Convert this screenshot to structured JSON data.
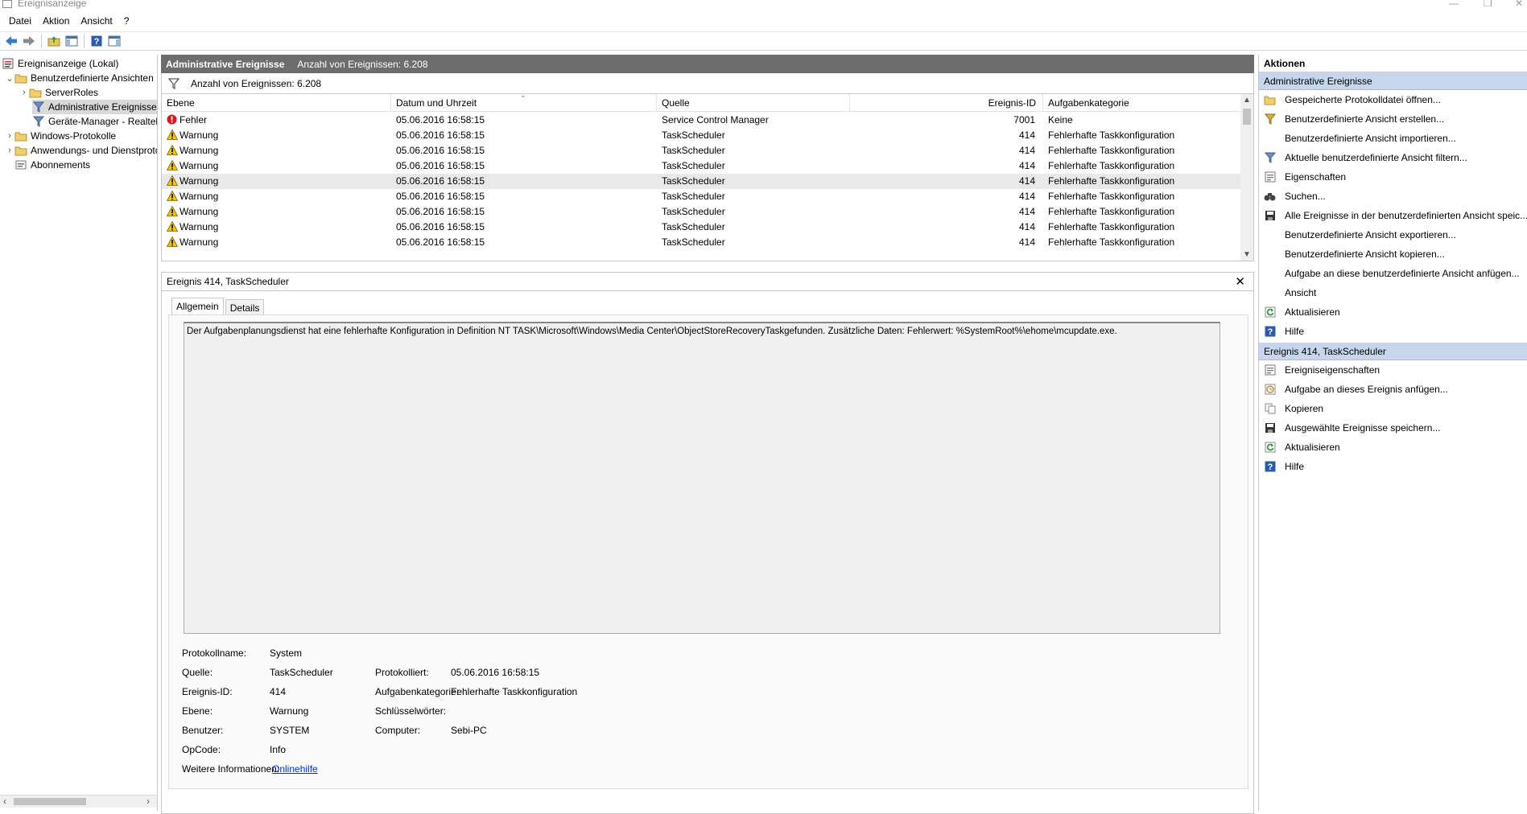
{
  "window": {
    "title": "Ereignisanzeige"
  },
  "menu": [
    "Datei",
    "Aktion",
    "Ansicht",
    "?"
  ],
  "tree": {
    "root": "Ereignisanzeige (Lokal)",
    "custom_views": "Benutzerdefinierte Ansichten",
    "server_roles": "ServerRoles",
    "admin_events": "Administrative Ereignisse",
    "device_manager": "Geräte-Manager - Realtek",
    "windows_logs": "Windows-Protokolle",
    "app_logs": "Anwendungs- und Dienstprotokolle",
    "subscriptions": "Abonnements"
  },
  "center": {
    "title": "Administrative Ereignisse",
    "count": "Anzahl von Ereignissen: 6.208",
    "filter_text": "Anzahl von Ereignissen: 6.208"
  },
  "grid": {
    "columns": [
      "Ebene",
      "Datum und Uhrzeit",
      "Quelle",
      "Ereignis-ID",
      "Aufgabenkategorie"
    ],
    "rows": [
      {
        "level": "Fehler",
        "type": "error",
        "date": "05.06.2016 16:58:15",
        "source": "Service Control Manager",
        "id": "7001",
        "category": "Keine"
      },
      {
        "level": "Warnung",
        "type": "warning",
        "date": "05.06.2016 16:58:15",
        "source": "TaskScheduler",
        "id": "414",
        "category": "Fehlerhafte Taskkonfiguration"
      },
      {
        "level": "Warnung",
        "type": "warning",
        "date": "05.06.2016 16:58:15",
        "source": "TaskScheduler",
        "id": "414",
        "category": "Fehlerhafte Taskkonfiguration"
      },
      {
        "level": "Warnung",
        "type": "warning",
        "date": "05.06.2016 16:58:15",
        "source": "TaskScheduler",
        "id": "414",
        "category": "Fehlerhafte Taskkonfiguration"
      },
      {
        "level": "Warnung",
        "type": "warning",
        "date": "05.06.2016 16:58:15",
        "source": "TaskScheduler",
        "id": "414",
        "category": "Fehlerhafte Taskkonfiguration"
      },
      {
        "level": "Warnung",
        "type": "warning",
        "date": "05.06.2016 16:58:15",
        "source": "TaskScheduler",
        "id": "414",
        "category": "Fehlerhafte Taskkonfiguration"
      },
      {
        "level": "Warnung",
        "type": "warning",
        "date": "05.06.2016 16:58:15",
        "source": "TaskScheduler",
        "id": "414",
        "category": "Fehlerhafte Taskkonfiguration"
      },
      {
        "level": "Warnung",
        "type": "warning",
        "date": "05.06.2016 16:58:15",
        "source": "TaskScheduler",
        "id": "414",
        "category": "Fehlerhafte Taskkonfiguration"
      },
      {
        "level": "Warnung",
        "type": "warning",
        "date": "05.06.2016 16:58:15",
        "source": "TaskScheduler",
        "id": "414",
        "category": "Fehlerhafte Taskkonfiguration"
      }
    ]
  },
  "detail": {
    "title": "Ereignis 414, TaskScheduler",
    "tabs": [
      "Allgemein",
      "Details"
    ],
    "message": "Der Aufgabenplanungsdienst hat eine fehlerhafte Konfiguration in Definition NT TASK\\Microsoft\\Windows\\Media Center\\ObjectStoreRecoveryTaskgefunden. Zusätzliche Daten: Fehlerwert: %SystemRoot%\\ehome\\mcupdate.exe.",
    "labels": {
      "log_name": "Protokollname:",
      "source": "Quelle:",
      "event_id": "Ereignis-ID:",
      "level": "Ebene:",
      "user": "Benutzer:",
      "opcode": "OpCode:",
      "more_info": "Weitere Informationen:",
      "logged": "Protokolliert:",
      "task_category": "Aufgabenkategorie:",
      "keywords": "Schlüsselwörter:",
      "computer": "Computer:"
    },
    "values": {
      "log_name": "System",
      "source": "TaskScheduler",
      "event_id": "414",
      "level": "Warnung",
      "user": "SYSTEM",
      "opcode": "Info",
      "more_info": "Onlinehilfe",
      "logged": "05.06.2016 16:58:15",
      "task_category": "Fehlerhafte Taskkonfiguration",
      "keywords": "",
      "computer": "Sebi-PC"
    }
  },
  "actions": {
    "title": "Aktionen",
    "section1": "Administrative Ereignisse",
    "items1": [
      {
        "label": "Gespeicherte Protokolldatei öffnen...",
        "icon": "open-folder-icon"
      },
      {
        "label": "Benutzerdefinierte Ansicht erstellen...",
        "icon": "filter-create-icon"
      },
      {
        "label": "Benutzerdefinierte Ansicht importieren...",
        "icon": ""
      },
      {
        "label": "Aktuelle benutzerdefinierte Ansicht filtern...",
        "icon": "filter-icon"
      },
      {
        "label": "Eigenschaften",
        "icon": "properties-icon"
      },
      {
        "label": "Suchen...",
        "icon": "binoculars-icon"
      },
      {
        "label": "Alle Ereignisse in der benutzerdefinierten Ansicht speic...",
        "icon": "save-icon"
      },
      {
        "label": "Benutzerdefinierte Ansicht exportieren...",
        "icon": ""
      },
      {
        "label": "Benutzerdefinierte Ansicht kopieren...",
        "icon": ""
      },
      {
        "label": "Aufgabe an diese benutzerdefinierte Ansicht anfügen...",
        "icon": ""
      },
      {
        "label": "Ansicht",
        "icon": ""
      },
      {
        "label": "Aktualisieren",
        "icon": "refresh-icon"
      },
      {
        "label": "Hilfe",
        "icon": "help-icon"
      }
    ],
    "section2": "Ereignis 414, TaskScheduler",
    "items2": [
      {
        "label": "Ereigniseigenschaften",
        "icon": "properties-icon"
      },
      {
        "label": "Aufgabe an dieses Ereignis anfügen...",
        "icon": "task-icon"
      },
      {
        "label": "Kopieren",
        "icon": "copy-icon"
      },
      {
        "label": "Ausgewählte Ereignisse speichern...",
        "icon": "save-icon"
      },
      {
        "label": "Aktualisieren",
        "icon": "refresh-icon"
      },
      {
        "label": "Hilfe",
        "icon": "help-icon"
      }
    ]
  },
  "colors": {
    "section_bg": "#c7d6ec",
    "header_bg": "#6d6d6d",
    "link": "#0033cc",
    "warning": "#f5c400",
    "error": "#d8141c"
  }
}
